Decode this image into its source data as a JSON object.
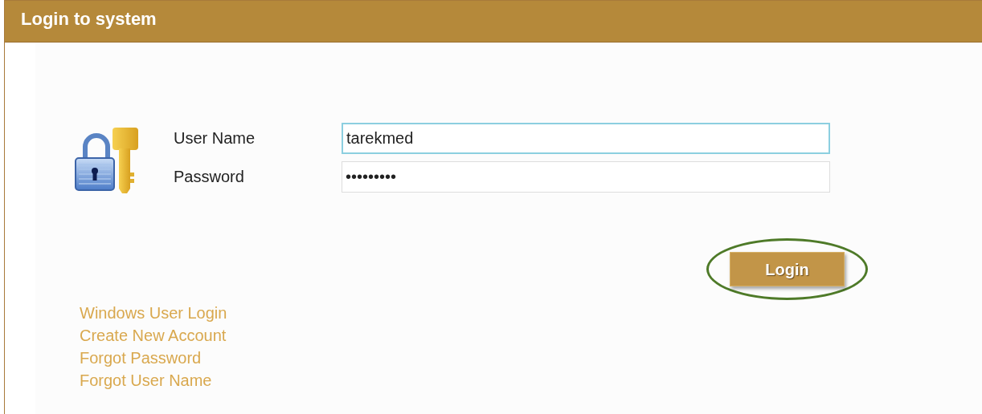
{
  "panel": {
    "title": "Login to system"
  },
  "fields": [
    {
      "label": "User Name",
      "value": "tarekmed",
      "focused": true
    },
    {
      "label": "Password",
      "value": "•••••••••",
      "focused": false
    }
  ],
  "login_button": {
    "label": "Login",
    "highlighted": true
  },
  "links": [
    "Windows User Login",
    "Create New Account",
    "Forgot Password",
    "Forgot User Name"
  ]
}
